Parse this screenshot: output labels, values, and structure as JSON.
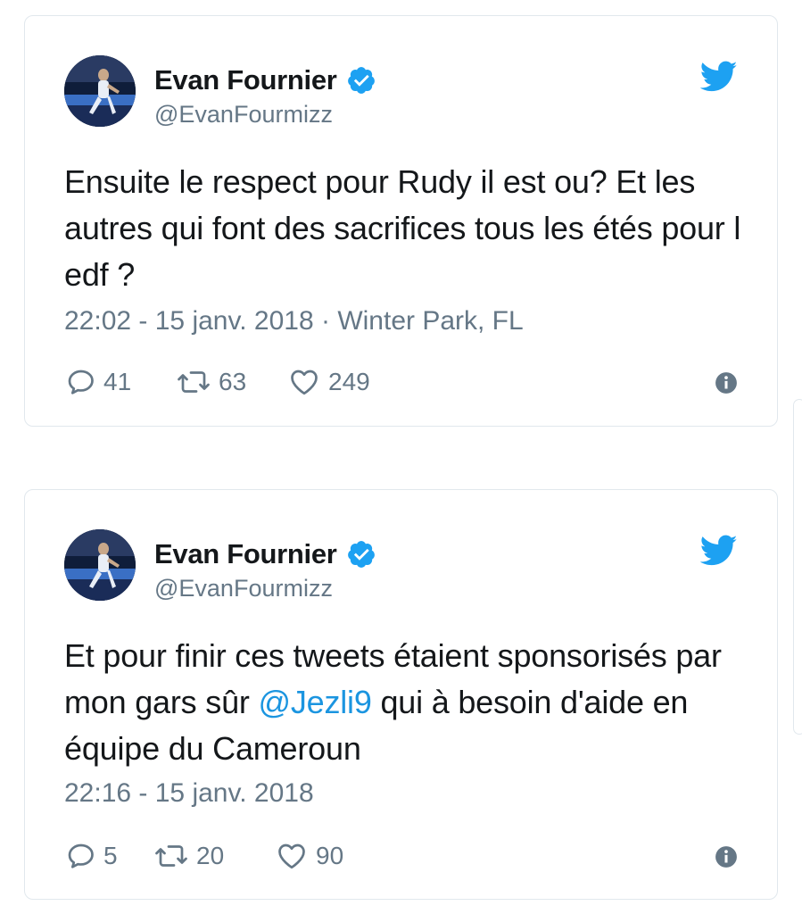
{
  "tweets": [
    {
      "display_name": "Evan Fournier",
      "handle": "@EvanFourmizz",
      "text": "Ensuite le respect pour Rudy il est ou? Et les autres qui font des sacrifices tous les étés pour l edf ?",
      "meta": "22:02 - 15 janv. 2018 · Winter Park, FL",
      "replies": "41",
      "retweets": "63",
      "likes": "249",
      "icons": [
        "verified-badge-icon",
        "twitter-bird-icon",
        "reply-icon",
        "retweet-icon",
        "like-icon",
        "info-icon"
      ]
    },
    {
      "display_name": "Evan Fournier",
      "handle": "@EvanFourmizz",
      "text_before": "Et pour finir ces tweets étaient sponsorisés par mon gars sûr ",
      "mention": "@Jezli9",
      "text_after": " qui à besoin d'aide en équipe du Cameroun",
      "meta": "22:16 - 15 janv. 2018",
      "replies": "5",
      "retweets": "20",
      "likes": "90",
      "icons": [
        "verified-badge-icon",
        "twitter-bird-icon",
        "reply-icon",
        "retweet-icon",
        "like-icon",
        "info-icon"
      ]
    }
  ],
  "colors": {
    "text": "#14171a",
    "muted": "#657786",
    "twitter_blue": "#1da1f2",
    "mention": "#1b95e0",
    "border": "#e1e8ed"
  }
}
